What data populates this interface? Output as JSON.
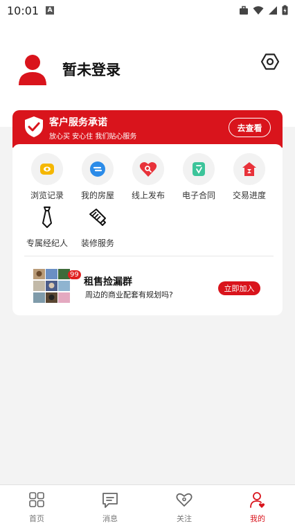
{
  "status": {
    "time": "10:01",
    "notif_icon": "A"
  },
  "profile": {
    "login_text": "暂未登录"
  },
  "service": {
    "title": "客户服务承诺",
    "subtitle": "放心买 安心住 我们贴心服务",
    "button": "去查看"
  },
  "menu": {
    "items": [
      {
        "label": "浏览记录",
        "icon": "browse-history-icon"
      },
      {
        "label": "我的房屋",
        "icon": "my-house-icon"
      },
      {
        "label": "线上发布",
        "icon": "online-publish-icon"
      },
      {
        "label": "电子合同",
        "icon": "e-contract-icon"
      },
      {
        "label": "交易进度",
        "icon": "transaction-progress-icon"
      },
      {
        "label": "专属经纪人",
        "icon": "tie-icon"
      },
      {
        "label": "装修服务",
        "icon": "brush-icon"
      }
    ]
  },
  "group": {
    "badge": "99",
    "title": "租售捡漏群",
    "desc": "周边的商业配套有规划吗?",
    "button": "立即加入"
  },
  "tabbar": {
    "tabs": [
      {
        "label": "首页"
      },
      {
        "label": "消息"
      },
      {
        "label": "关注"
      },
      {
        "label": "我的"
      }
    ]
  },
  "colors": {
    "accent": "#d9141c"
  }
}
